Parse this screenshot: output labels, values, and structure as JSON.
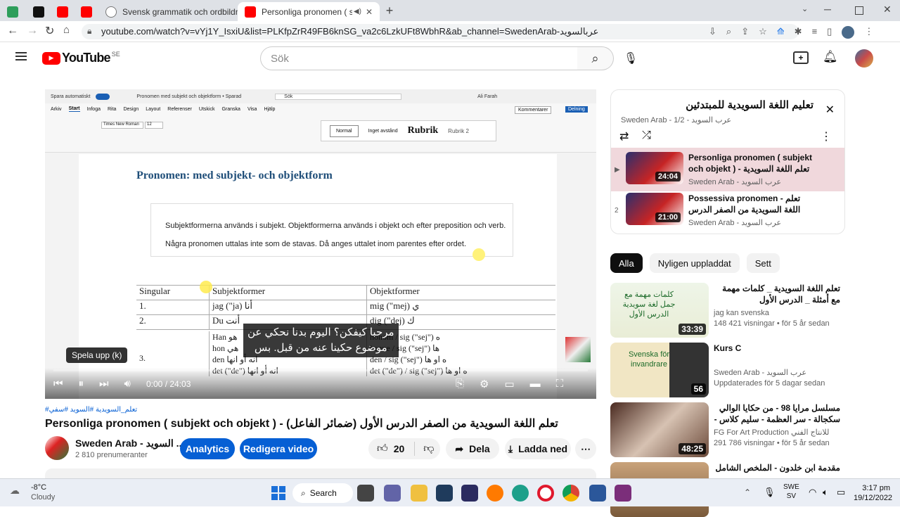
{
  "browser": {
    "tabs": [
      {
        "label": "Svensk grammatik och ordbildni"
      },
      {
        "label": "Personliga pronomen ( subje"
      }
    ],
    "url": "youtube.com/watch?v=vYj1Y_IsxiU&list=PLKfpZrR49FB6knSG_va2c6LzkUFt8WbhR&ab_channel=SwedenArab-عربالسويد"
  },
  "youtube": {
    "country": "SE",
    "search_placeholder": "Sök"
  },
  "video": {
    "hashtags": "#تعلم_السويدية #السويد #سفي",
    "title": "Personliga pronomen ( subjekt och objekt ) - تعلم اللغة السويدية من الصفر الدرس الأول (ضمائر الفاعل)",
    "channel": "Sweden Arab - السويد ...",
    "subscribers": "2 810 prenumeranter",
    "analytics_label": "Analytics",
    "edit_label": "Redigera video",
    "likes": "20",
    "share_label": "Dela",
    "download_label": "Ladda ned",
    "time": "0:00 / 24:03",
    "tooltip": "Spela upp (k)",
    "subtitle_line1": "مرحبا كيفكن؟ اليوم بدنا نحكي عن",
    "subtitle_line2": "موضوع حكينا عنه من قبل. بس",
    "doc": {
      "autosave": "Spara automatiskt",
      "doc_title": "Pronomen med subjekt och objektform • Sparad",
      "search": "Sök",
      "user": "Ali Farah",
      "menu": [
        "Arkiv",
        "Start",
        "Infoga",
        "Rita",
        "Design",
        "Layout",
        "Referenser",
        "Utskick",
        "Granska",
        "Visa",
        "Hjälp"
      ],
      "comments": "Kommentarer",
      "share": "Delning",
      "font": "Times New Roman",
      "size": "12",
      "styles": [
        "Normal",
        "Inget avstånd",
        "Rubrik",
        "Rubrik 2"
      ],
      "heading": "Pronomen: med subjekt- och objektform",
      "para1": "Subjektformerna används i subjekt. Objektformerna används i objekt och efter preposition och verb.",
      "para2": "Några pronomen uttalas inte som de stavas. Då anges uttalet inom parentes efter ordet.",
      "table_headers": [
        "Singular",
        "Subjektformer",
        "Objektformer"
      ],
      "rows": [
        {
          "n": "1.",
          "subj": "jag (\"ja)   أنا",
          "obj": "mig (\"mej)   ي"
        },
        {
          "n": "2.",
          "subj": "Du          أنت",
          "obj": "dig (\"dej)   ك"
        }
      ],
      "row3_subj": [
        "Han    هو",
        "hon    هي",
        "den   انه أو انها",
        "det (\"de\")  انه أو انها"
      ],
      "row3_obj": [
        "honom / sig (\"sej\")   ه",
        "henne / sig (\"sej\")   ها",
        "den / sig (\"sej\")   ه او ها",
        "det (\"de\") / sig (\"sej\")   ه او ها"
      ],
      "row3_n": "3."
    }
  },
  "playlist": {
    "title": "تعليم اللغة السويدية للمبتدئين",
    "meta": "Sweden Arab - عرب السويد - 1/2",
    "items": [
      {
        "index": "▶",
        "title": "Personliga pronomen ( subjekt och objekt ) - تعلم اللغة السويدية من ...",
        "channel": "Sweden Arab - عرب السويد",
        "duration": "24:04"
      },
      {
        "index": "2",
        "title": "Possessiva pronomen - تعلم اللغة السويدية من الصفر الدرس الثاني (ضمائر ...",
        "channel": "Sweden Arab - عرب السويد",
        "duration": "21:00"
      }
    ]
  },
  "filters": [
    "Alla",
    "Nyligen uppladdat",
    "Sett"
  ],
  "recommendations": [
    {
      "title": "تعلم اللغة السويدية _ كلمات مهمة مع أمثلة _ الدرس الأول",
      "channel": "jag kan svenska",
      "meta": "148 421 visningar  •  för 5 år sedan",
      "duration": "33:39",
      "thumb_text": "كلمات مهمة مع جمل لغة سويدية الدرس الأول"
    },
    {
      "title": "Kurs C",
      "channel": "Sweden Arab - عرب السويد",
      "meta": "Uppdaterades för 5 dagar sedan",
      "duration": "56",
      "thumb_text": "Svenska för invandrare"
    },
    {
      "title": "مسلسل مرايا 98 - من حكايا الوالي سكجالة - سر العظمة - سليم كلاس - سلمى المصري -",
      "channel": "FG For Art Production للانتاج الفني",
      "meta": "291 786 visningar  •  för 5 år sedan",
      "duration": "48:25",
      "thumb_text": ""
    },
    {
      "title": "مقدمة ابن خلدون - الملخص الشامل",
      "channel": "",
      "meta": "",
      "duration": "",
      "thumb_text": ""
    }
  ],
  "taskbar": {
    "weather_temp": "-8°C",
    "weather_desc": "Cloudy",
    "search": "Search",
    "lang1": "SWE",
    "lang2": "SV",
    "time": "3:17 pm",
    "date": "19/12/2022"
  },
  "colors": {
    "yt_red": "#ff0000",
    "accent_blue": "#065fd4",
    "btn_blue": "#0b57d0"
  }
}
